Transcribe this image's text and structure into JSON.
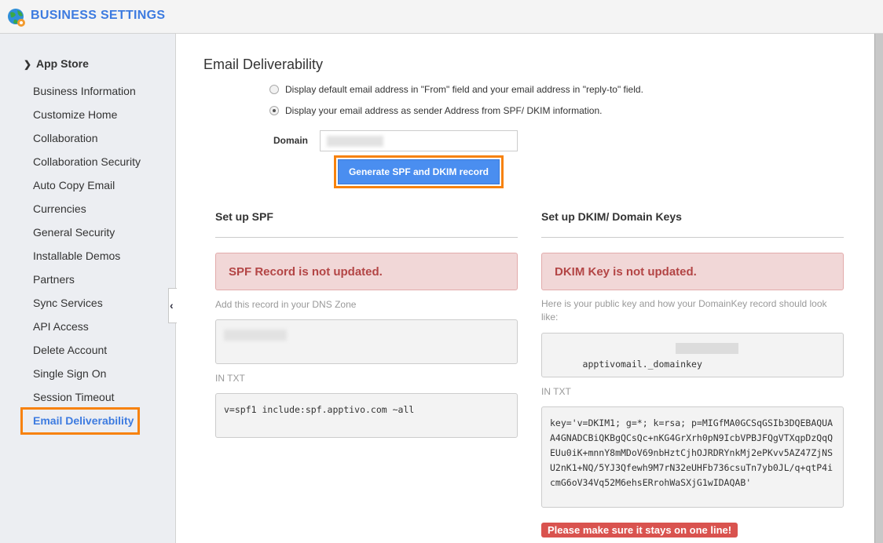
{
  "header": {
    "title": "BUSINESS SETTINGS",
    "logo_icon": "globe-gear-icon"
  },
  "sidebar": {
    "section": "App Store",
    "items": [
      {
        "label": "Business Information"
      },
      {
        "label": "Customize Home"
      },
      {
        "label": "Collaboration"
      },
      {
        "label": "Collaboration Security"
      },
      {
        "label": "Auto Copy Email"
      },
      {
        "label": "Currencies"
      },
      {
        "label": "General Security"
      },
      {
        "label": "Installable Demos"
      },
      {
        "label": "Partners"
      },
      {
        "label": "Sync Services"
      },
      {
        "label": "API Access"
      },
      {
        "label": "Delete Account"
      },
      {
        "label": "Single Sign On"
      },
      {
        "label": "Session Timeout"
      },
      {
        "label": "Email Deliverability",
        "active": true
      }
    ],
    "collapse_glyph": "‹"
  },
  "main": {
    "title": "Email Deliverability",
    "options": [
      {
        "label": "Display default email address in \"From\" field and your email address in \"reply-to\" field.",
        "checked": false
      },
      {
        "label": "Display your email address as sender Address from SPF/ DKIM information.",
        "checked": true
      }
    ],
    "domain_label": "Domain",
    "domain_value": "",
    "generate_button": "Generate SPF and DKIM record",
    "spf": {
      "title": "Set up SPF",
      "alert": "SPF Record is not updated.",
      "hint": "Add this record in your DNS Zone",
      "in_txt": "IN TXT",
      "record": "v=spf1 include:spf.apptivo.com ~all"
    },
    "dkim": {
      "title": "Set up DKIM/ Domain Keys",
      "alert": "DKIM Key is not updated.",
      "hint": "Here is your public key and how your DomainKey record should look like:",
      "host": "apptivomail._domainkey",
      "in_txt": "IN TXT",
      "record": "key='v=DKIM1; g=*; k=rsa; p=MIGfMA0GCSqGSIb3DQEBAQUAA4GNADCBiQKBgQCsQc+nKG4GrXrh0pN9IcbVPBJFQgVTXqpDzQqQEUu0iK+mnnY8mMDoV69nbHztCjhOJRDRYnkMj2ePKvv5AZ47ZjNSU2nK1+NQ/5YJ3Qfewh9M7rN32eUHFb736csuTn7yb0JL/q+qtP4icmG6oV34Vq52M6ehsERrohWaSXjG1wIDAQAB'",
      "warning": "Please make sure it stays on one line!"
    }
  }
}
